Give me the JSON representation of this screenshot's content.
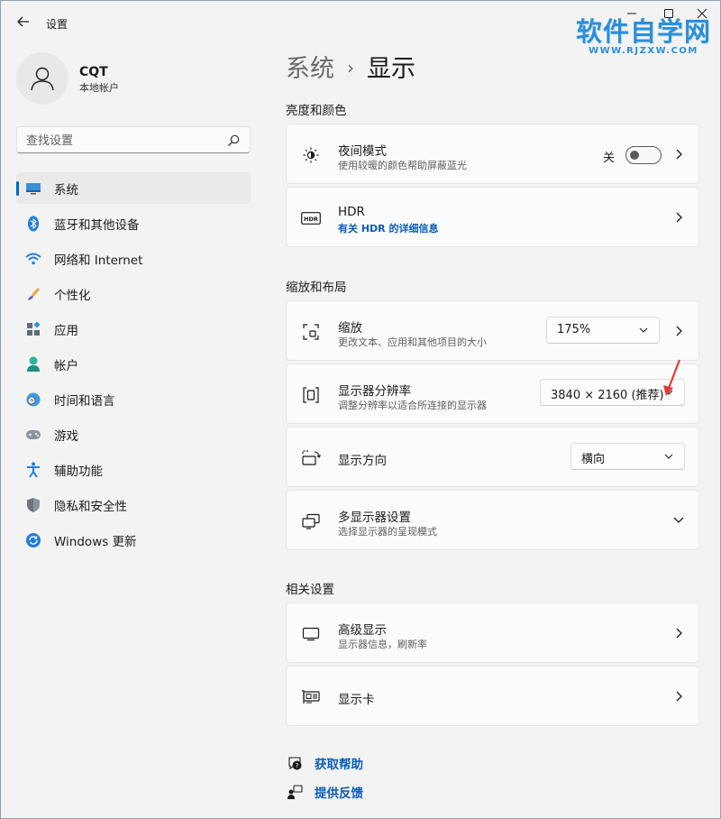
{
  "window": {
    "title": "设置"
  },
  "watermark": {
    "main": "软件自学网",
    "sub": "WWW.RJZXW.COM"
  },
  "user": {
    "name": "CQT",
    "account_type": "本地帐户"
  },
  "search": {
    "placeholder": "查找设置"
  },
  "sidebar": {
    "items": [
      {
        "label": "系统",
        "icon": "monitor-icon",
        "active": true
      },
      {
        "label": "蓝牙和其他设备",
        "icon": "bluetooth-icon"
      },
      {
        "label": "网络和 Internet",
        "icon": "wifi-icon"
      },
      {
        "label": "个性化",
        "icon": "brush-icon"
      },
      {
        "label": "应用",
        "icon": "apps-icon"
      },
      {
        "label": "帐户",
        "icon": "person-icon"
      },
      {
        "label": "时间和语言",
        "icon": "globe-clock-icon"
      },
      {
        "label": "游戏",
        "icon": "gamepad-icon"
      },
      {
        "label": "辅助功能",
        "icon": "accessibility-icon"
      },
      {
        "label": "隐私和安全性",
        "icon": "shield-icon"
      },
      {
        "label": "Windows 更新",
        "icon": "update-icon"
      }
    ]
  },
  "breadcrumb": {
    "parent": "系统",
    "separator": "›",
    "current": "显示"
  },
  "sections": {
    "brightness": "亮度和颜色",
    "scale_layout": "缩放和布局",
    "related": "相关设置"
  },
  "cards": {
    "night_light": {
      "title": "夜间模式",
      "desc": "使用较暖的颜色帮助屏蔽蓝光",
      "toggle_label": "关",
      "toggle_on": false
    },
    "hdr": {
      "title": "HDR",
      "link": "有关 HDR 的详细信息"
    },
    "scale": {
      "title": "缩放",
      "desc": "更改文本、应用和其他项目的大小",
      "value": "175%"
    },
    "resolution": {
      "title": "显示器分辨率",
      "desc": "调整分辨率以适合所连接的显示器",
      "value": "3840 × 2160 (推荐)"
    },
    "orientation": {
      "title": "显示方向",
      "value": "横向"
    },
    "multi_display": {
      "title": "多显示器设置",
      "desc": "选择显示器的呈现模式"
    },
    "advanced": {
      "title": "高级显示",
      "desc": "显示器信息，刷新率"
    },
    "graphics": {
      "title": "显示卡"
    }
  },
  "footer": {
    "help": "获取帮助",
    "feedback": "提供反馈"
  },
  "colors": {
    "accent": "#0067c0",
    "link": "#0a5cb8",
    "watermark": "#2b8fd9",
    "annotation_arrow": "#e53935"
  }
}
